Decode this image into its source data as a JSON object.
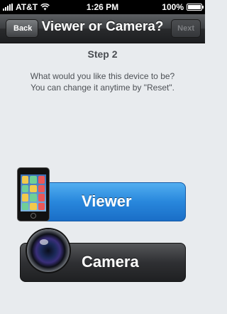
{
  "status_bar": {
    "carrier": "AT&T",
    "time": "1:26 PM",
    "battery": "100%",
    "battery_level": 1.0
  },
  "nav": {
    "back_label": "Back",
    "title": "Viewer or Camera?",
    "next_label": "Next"
  },
  "content": {
    "step": "Step 2",
    "description_line1": "What would you like this device to be?",
    "description_line2": "You can change it anytime by \"Reset\"."
  },
  "buttons": {
    "viewer_label": "Viewer",
    "camera_label": "Camera"
  },
  "colors": {
    "viewer_button": "#2887dc",
    "camera_button": "#2f3033",
    "nav_bar": "#2a2b2d",
    "background": "#e8ebee"
  },
  "icons": {
    "viewer": "iphone-icon",
    "camera": "camera-lens-icon",
    "signal": "signal-bars-icon",
    "wifi": "wifi-icon",
    "battery": "battery-icon"
  }
}
